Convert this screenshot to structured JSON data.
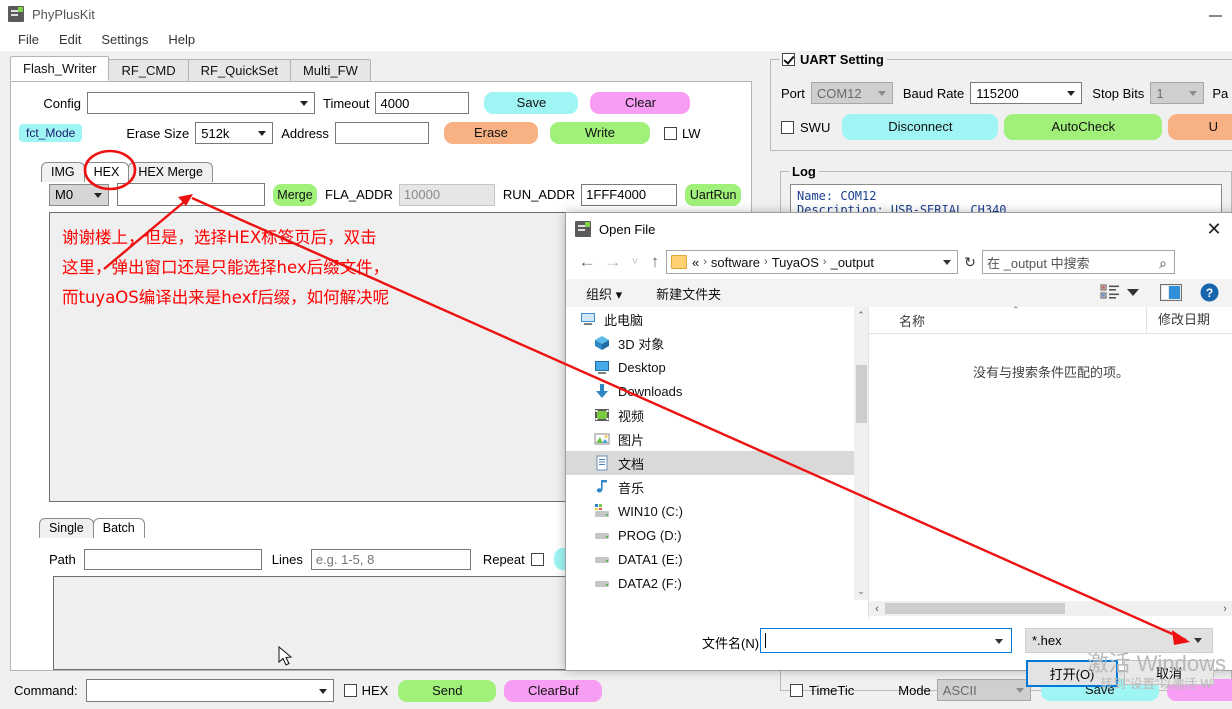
{
  "app": {
    "title": "PhyPlusKit",
    "icon": "app-icon",
    "minimize": "—"
  },
  "menu": [
    "File",
    "Edit",
    "Settings",
    "Help"
  ],
  "tabs": [
    {
      "label": "Flash_Writer",
      "active": true
    },
    {
      "label": "RF_CMD",
      "active": false
    },
    {
      "label": "RF_QuickSet",
      "active": false
    },
    {
      "label": "Multi_FW",
      "active": false
    }
  ],
  "flash_writer": {
    "config_label": "Config",
    "config_value": "",
    "timeout_label": "Timeout",
    "timeout_value": "4000",
    "save_label": "Save",
    "clear_label": "Clear",
    "fct_mode": "fct_Mode",
    "erase_size_label": "Erase Size",
    "erase_size_value": "512k",
    "address_label": "Address",
    "address_value": "",
    "erase_label": "Erase",
    "write_label": "Write",
    "lw_label": "LW",
    "lw_checked": false,
    "subtabs": [
      {
        "label": "IMG",
        "active": false
      },
      {
        "label": "HEX",
        "active": true
      },
      {
        "label": "HEX Merge",
        "active": false
      }
    ],
    "m0_value": "M0",
    "hexpath_value": "",
    "merge_label": "Merge",
    "fla_addr_label": "FLA_ADDR",
    "fla_addr_value": "10000",
    "run_addr_label": "RUN_ADDR",
    "run_addr_value": "1FFF4000",
    "uartrun_label": "UartRun",
    "annotation": [
      "谢谢楼上，但是，选择HEX标签页后，双击",
      "这里，弹出窗口还是只能选择hex后缀文件，",
      "而tuyaOS编译出来是hexf后缀，如何解决呢"
    ],
    "annotation_color": "#ff0000",
    "batch_subtabs": [
      {
        "label": "Single",
        "active": false
      },
      {
        "label": "Batch",
        "active": true
      }
    ],
    "path_label": "Path",
    "path_value": "",
    "lines_label": "Lines",
    "lines_placeholder": "e.g. 1-5, 8",
    "repeat_label": "Repeat",
    "repeat_checked": false
  },
  "command_bar": {
    "label": "Command:",
    "value": "",
    "hex_label": "HEX",
    "hex_checked": false,
    "send_label": "Send",
    "clearbuf_label": "ClearBuf"
  },
  "uart": {
    "group_title": "UART Setting",
    "group_checked": true,
    "port_label": "Port",
    "port_value": "COM12",
    "baud_label": "Baud Rate",
    "baud_value": "115200",
    "stopbits_label": "Stop Bits",
    "stopbits_value": "1",
    "parity_label": "Pa",
    "swu_label": "SWU",
    "swu_checked": false,
    "disconnect_label": "Disconnect",
    "autocheck_label": "AutoCheck",
    "update_label": "U"
  },
  "log": {
    "title": "Log",
    "lines": [
      "Name: COM12",
      "Description: USB-SERIAL CH340"
    ]
  },
  "bottom_right": {
    "timetic_label": "TimeTic",
    "timetic_checked": false,
    "mode_label": "Mode",
    "mode_value": "ASCII",
    "save_label": "Save"
  },
  "dialog": {
    "title": "Open File",
    "close": "✕",
    "nav": {
      "back": "←",
      "forward": "→",
      "recent": "˅",
      "up": "↑"
    },
    "breadcrumbs": [
      "«",
      "software",
      "TuyaOS",
      "_output"
    ],
    "refresh": "↻",
    "search_placeholder": "在 _output 中搜索",
    "commands": [
      "组织 ▾",
      "新建文件夹"
    ],
    "view_icons": [
      "list-view-icon",
      "chevron-down-icon",
      "preview-pane-icon",
      "help-icon"
    ],
    "nav_items": [
      {
        "label": "此电脑",
        "icon": "computer-icon",
        "indent": 0,
        "selected": false
      },
      {
        "label": "3D 对象",
        "icon": "3d-objects-icon",
        "indent": 1,
        "selected": false
      },
      {
        "label": "Desktop",
        "icon": "desktop-icon",
        "indent": 1,
        "selected": false
      },
      {
        "label": "Downloads",
        "icon": "downloads-icon",
        "indent": 1,
        "selected": false
      },
      {
        "label": "视频",
        "icon": "videos-icon",
        "indent": 1,
        "selected": false
      },
      {
        "label": "图片",
        "icon": "pictures-icon",
        "indent": 1,
        "selected": false
      },
      {
        "label": "文档",
        "icon": "documents-icon",
        "indent": 1,
        "selected": true
      },
      {
        "label": "音乐",
        "icon": "music-icon",
        "indent": 1,
        "selected": false
      },
      {
        "label": "WIN10 (C:)",
        "icon": "drive-c-icon",
        "indent": 1,
        "selected": false
      },
      {
        "label": "PROG (D:)",
        "icon": "drive-d-icon",
        "indent": 1,
        "selected": false
      },
      {
        "label": "DATA1 (E:)",
        "icon": "drive-e-icon",
        "indent": 1,
        "selected": false
      },
      {
        "label": "DATA2 (F:)",
        "icon": "drive-f-icon",
        "indent": 1,
        "selected": false
      }
    ],
    "columns": [
      "名称",
      "修改日期"
    ],
    "empty_message": "没有与搜索条件匹配的项。",
    "filename_label": "文件名(N):",
    "filename_value": "",
    "filter_value": "*.hex",
    "open_label": "打开(O)",
    "cancel_label": "取消"
  },
  "watermark": {
    "line1": "激活 Windows",
    "line2": "转到\"设置\"以激活 W"
  }
}
